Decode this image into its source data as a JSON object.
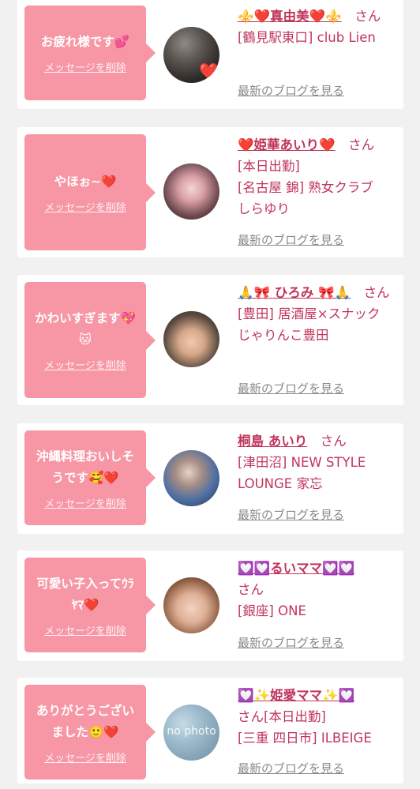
{
  "delete_label": "メッセージを削除",
  "blog_label": "最新のブログを見る",
  "san_label": "さん",
  "cards": [
    {
      "message": "お疲れ様です💕",
      "name": "⚜️❤️真由美❤️⚜️",
      "shop": "[鶴見駅東口] club Lien"
    },
    {
      "message": "やほぉ~❤️",
      "name": "❤️姫華あいり❤️",
      "shop": "[本日出勤]\n[名古屋 錦] 熟女クラブ\nしらゆり"
    },
    {
      "message": "かわいすぎます💖\n🐱",
      "name": "🙏🎀 ひろみ 🎀🙏",
      "shop": "[豊田] 居酒屋×スナック\nじゃりんこ豊田"
    },
    {
      "message": "沖縄料理おいしそ\nうです🥰❤️",
      "name": "桐島 あいり",
      "shop": "[津田沼] NEW STYLE\nLOUNGE 家忘"
    },
    {
      "message": "可愛い子入ってｳﾗ\nﾔﾏ❤️",
      "name": "💟💟るいママ💟💟",
      "shop": "[銀座] ONE"
    },
    {
      "message": "ありがとうござい\nました🙂❤️",
      "name": "💟✨姫愛ママ✨💟",
      "shop": "[本日出勤]\n[三重 四日市] ILBEIGE"
    }
  ],
  "no_photo_label": "no photo",
  "colors": {
    "bubble": "#f796a4",
    "accent_text": "#c1355b",
    "link_gray": "#8a8a8a",
    "background": "#f1f1f1"
  }
}
